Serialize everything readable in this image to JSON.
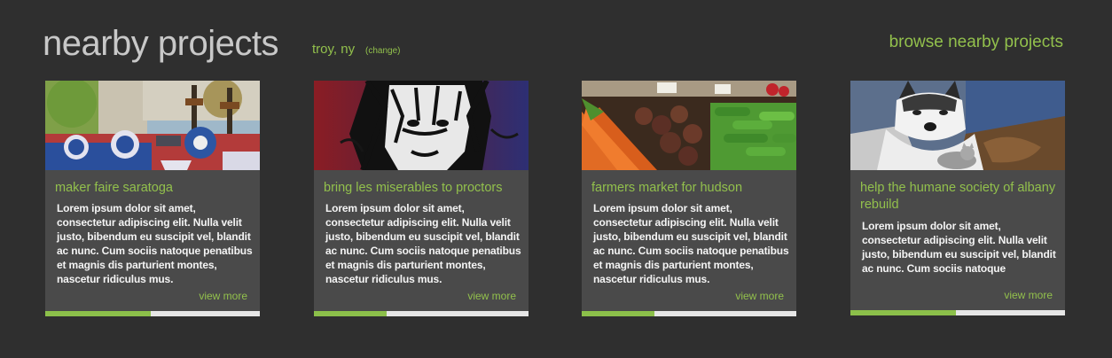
{
  "header": {
    "title": "nearby projects",
    "location": "troy, ny",
    "change_label": "(change)",
    "browse_label": "browse nearby projects"
  },
  "colors": {
    "background": "#2f2f2f",
    "card_background": "#4a4a4a",
    "accent_green": "#92c04c",
    "progress_track": "#e6e6e6"
  },
  "projects": [
    {
      "title": "maker faire saratoga",
      "description": "Lorem ipsum dolor sit amet, consectetur adipiscing elit. Nulla velit justo, bibendum eu suscipit vel, blandit ac nunc. Cum sociis natoque penatibus et magnis dis parturient montes, nascetur ridiculus mus.",
      "link_label": "view more",
      "progress": 0.49,
      "image_icon": "parade-photo"
    },
    {
      "title": "bring les miserables to proctors",
      "description": "Lorem ipsum dolor sit amet, consectetur adipiscing elit. Nulla velit justo, bibendum eu suscipit vel, blandit ac nunc. Cum sociis natoque penatibus et magnis dis parturient montes, nascetur ridiculus mus.",
      "link_label": "view more",
      "progress": 0.34,
      "image_icon": "les-miserables-poster"
    },
    {
      "title": "farmers market for hudson",
      "description": "Lorem ipsum dolor sit amet, consectetur adipiscing elit. Nulla velit justo, bibendum eu suscipit vel, blandit ac nunc. Cum sociis natoque penatibus et magnis dis parturient montes, nascetur ridiculus mus.",
      "link_label": "view more",
      "progress": 0.34,
      "image_icon": "vegetables-photo"
    },
    {
      "title": "help the humane society of albany rebuild",
      "description": "Lorem ipsum dolor sit amet, consectetur adipiscing elit. Nulla velit justo, bibendum eu suscipit vel, blandit ac nunc. Cum sociis natoque",
      "link_label": "view more",
      "progress": 0.49,
      "image_icon": "dog-and-cat-photo"
    }
  ]
}
